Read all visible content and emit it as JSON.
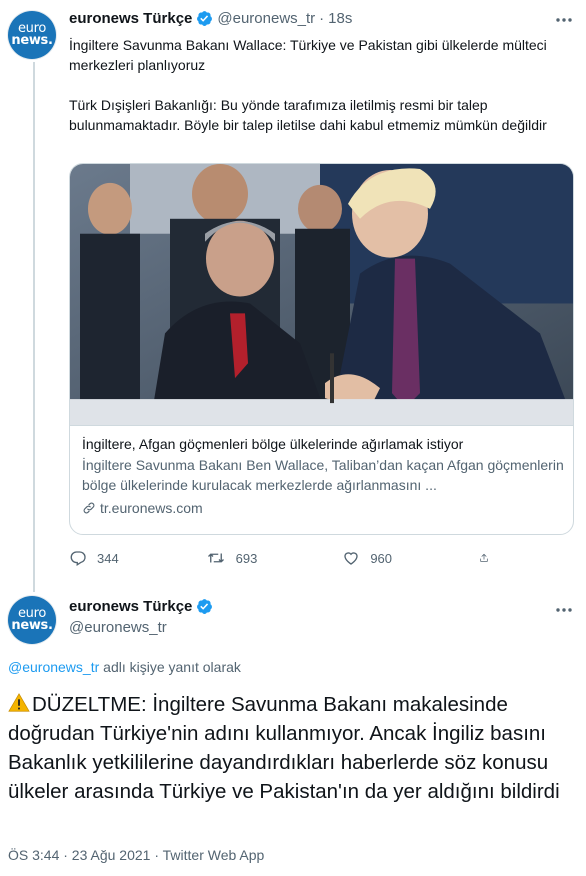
{
  "colors": {
    "accent": "#1d9bf0",
    "avatar_bg": "#1a74b8",
    "text": "#0f1419",
    "muted": "#536471"
  },
  "avatar": {
    "line1": "euro",
    "line2": "news."
  },
  "tweet1": {
    "name": "euronews Türkçe",
    "handle": "@euronews_tr",
    "separator": "·",
    "time": "18s",
    "paragraph1": "İngiltere Savunma Bakanı Wallace: Türkiye ve Pakistan gibi ülkelerde mülteci merkezleri planlıyoruz",
    "paragraph2": "Türk Dışişleri Bakanlığı: Bu yönde tarafımıza iletilmiş resmi bir talep bulunmamaktadır. Böyle bir talep iletilse dahi kabul etmemiz mümkün değildir",
    "card": {
      "title": "İngiltere, Afgan göçmenleri bölge ülkelerinde ağırlamak istiyor",
      "description": "İngiltere Savunma Bakanı Ben Wallace, Taliban’dan kaçan Afgan göçmenlerin bölge ülkelerinde kurulacak merkezlerde ağırlanmasını ...",
      "link": "tr.euronews.com"
    },
    "actions": {
      "replies": "344",
      "retweets": "693",
      "likes": "960"
    }
  },
  "tweet2": {
    "name": "euronews Türkçe",
    "handle": "@euronews_tr",
    "reply_handle": "@euronews_tr",
    "reply_suffix": " adlı kişiye yanıt olarak",
    "text": "DÜZELTME: İngiltere Savunma Bakanı makalesinde doğrudan Türkiye'nin adını kullanmıyor. Ancak İngiliz basını Bakanlık yetkililerine dayandırdıkları haberlerde söz konusu ülkeler arasında Türkiye ve Pakistan'ın da yer aldığını bildirdi",
    "meta": "ÖS 3:44 · 23 Ağu 2021 · Twitter Web App"
  }
}
